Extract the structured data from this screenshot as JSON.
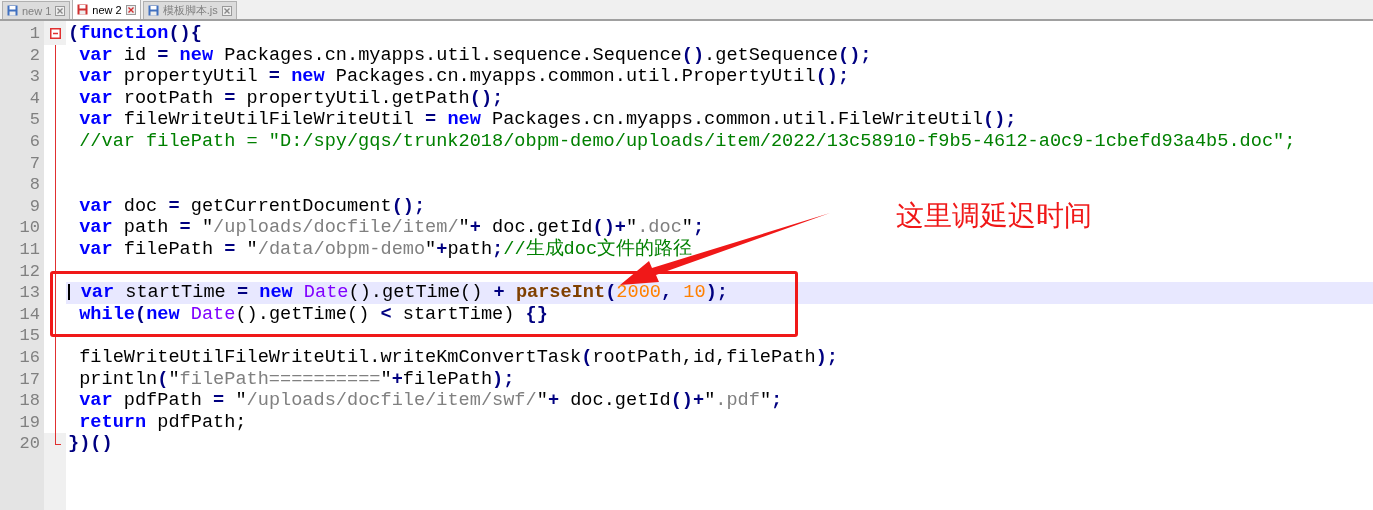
{
  "tabs": [
    {
      "label": "new 1",
      "selected": false
    },
    {
      "label": "new 2",
      "selected": true
    },
    {
      "label": "模板脚本.js",
      "selected": false
    }
  ],
  "lines": [
    {
      "number": "1",
      "kind": "fold_start",
      "current": false,
      "tokens": [
        {
          "kind": "operator",
          "t": "("
        },
        {
          "kind": "keyword",
          "t": "function"
        },
        {
          "kind": "operator",
          "t": "(){"
        }
      ]
    },
    {
      "number": "2",
      "kind": "folded",
      "current": false,
      "tokens": [
        {
          "kind": "keyword",
          "t": " var"
        },
        {
          "kind": "plain",
          "t": " id "
        },
        {
          "kind": "operator",
          "t": "="
        },
        {
          "kind": "keyword",
          "t": " new"
        },
        {
          "kind": "plain",
          "t": " Packages.cn.myapps.util.sequence.Sequence"
        },
        {
          "kind": "operator",
          "t": "()"
        },
        {
          "kind": "plain",
          "t": ".getSequence"
        },
        {
          "kind": "operator",
          "t": "();"
        }
      ]
    },
    {
      "number": "3",
      "kind": "folded",
      "current": false,
      "tokens": [
        {
          "kind": "keyword",
          "t": " var"
        },
        {
          "kind": "plain",
          "t": " propertyUtil "
        },
        {
          "kind": "operator",
          "t": "="
        },
        {
          "kind": "keyword",
          "t": " new"
        },
        {
          "kind": "plain",
          "t": " Packages.cn.myapps.common.util.PropertyUtil"
        },
        {
          "kind": "operator",
          "t": "();"
        }
      ]
    },
    {
      "number": "4",
      "kind": "folded",
      "current": false,
      "tokens": [
        {
          "kind": "keyword",
          "t": " var"
        },
        {
          "kind": "plain",
          "t": " rootPath "
        },
        {
          "kind": "operator",
          "t": "="
        },
        {
          "kind": "plain",
          "t": " propertyUtil.getPath"
        },
        {
          "kind": "operator",
          "t": "();"
        }
      ]
    },
    {
      "number": "5",
      "kind": "folded",
      "current": false,
      "tokens": [
        {
          "kind": "keyword",
          "t": " var"
        },
        {
          "kind": "plain",
          "t": " fileWriteUtilFileWriteUtil "
        },
        {
          "kind": "operator",
          "t": "="
        },
        {
          "kind": "keyword",
          "t": " new"
        },
        {
          "kind": "plain",
          "t": " Packages.cn.myapps.common.util.FileWriteUtil"
        },
        {
          "kind": "operator",
          "t": "();"
        }
      ]
    },
    {
      "number": "6",
      "kind": "folded",
      "current": false,
      "tokens": [
        {
          "kind": "comment",
          "t": " //var filePath = \"D:/spy/gqs/trunk2018/obpm-demo/uploads/item/2022/13c58910-f9b5-4612-a0c9-1cbefd93a4b5.doc\";"
        }
      ]
    },
    {
      "number": "7",
      "kind": "folded",
      "current": false
    },
    {
      "number": "8",
      "kind": "folded",
      "current": false
    },
    {
      "number": "9",
      "kind": "folded",
      "current": false,
      "tokens": [
        {
          "kind": "keyword",
          "t": " var"
        },
        {
          "kind": "plain",
          "t": " doc "
        },
        {
          "kind": "operator",
          "t": "="
        },
        {
          "kind": "plain",
          "t": " getCurrentDocument"
        },
        {
          "kind": "operator",
          "t": "();"
        }
      ]
    },
    {
      "number": "10",
      "kind": "folded",
      "current": false,
      "tokens": [
        {
          "kind": "keyword",
          "t": " var"
        },
        {
          "kind": "plain",
          "t": " path "
        },
        {
          "kind": "operator",
          "t": "="
        },
        {
          "kind": "quote",
          "t": " \""
        },
        {
          "kind": "string",
          "t": "/uploads/docfile/item/"
        },
        {
          "kind": "quote",
          "t": "\""
        },
        {
          "kind": "operator",
          "t": "+"
        },
        {
          "kind": "plain",
          "t": " doc.getId"
        },
        {
          "kind": "operator",
          "t": "()+"
        },
        {
          "kind": "quote",
          "t": "\""
        },
        {
          "kind": "string",
          "t": ".doc"
        },
        {
          "kind": "quote",
          "t": "\""
        },
        {
          "kind": "operator",
          "t": ";"
        }
      ]
    },
    {
      "number": "11",
      "kind": "folded",
      "current": false,
      "tokens": [
        {
          "kind": "keyword",
          "t": " var"
        },
        {
          "kind": "plain",
          "t": " filePath "
        },
        {
          "kind": "operator",
          "t": "="
        },
        {
          "kind": "quote",
          "t": " \""
        },
        {
          "kind": "string",
          "t": "/data/obpm-demo"
        },
        {
          "kind": "quote",
          "t": "\""
        },
        {
          "kind": "operator",
          "t": "+"
        },
        {
          "kind": "plain",
          "t": "path"
        },
        {
          "kind": "operator",
          "t": ";"
        },
        {
          "kind": "comment",
          "t": "//生成doc文件的路径"
        }
      ]
    },
    {
      "number": "12",
      "kind": "folded",
      "current": false
    },
    {
      "number": "13",
      "kind": "folded",
      "current": true,
      "tokens": [
        {
          "kind": "keyword",
          "t": " var"
        },
        {
          "kind": "plain",
          "t": " startTime "
        },
        {
          "kind": "operator",
          "t": "="
        },
        {
          "kind": "keyword",
          "t": " new"
        },
        {
          "kind": "type",
          "t": " Date"
        },
        {
          "kind": "plain",
          "t": "().getTime() "
        },
        {
          "kind": "operator",
          "t": "+"
        },
        {
          "kind": "function",
          "t": " parseInt"
        },
        {
          "kind": "operator",
          "t": "("
        },
        {
          "kind": "number",
          "t": "2000"
        },
        {
          "kind": "operator",
          "t": ","
        },
        {
          "kind": "number",
          "t": " 10"
        },
        {
          "kind": "operator",
          "t": ");"
        }
      ]
    },
    {
      "number": "14",
      "kind": "folded",
      "current": false,
      "tokens": [
        {
          "kind": "keyword",
          "t": " while"
        },
        {
          "kind": "operator",
          "t": "("
        },
        {
          "kind": "keyword",
          "t": "new"
        },
        {
          "kind": "type",
          "t": " Date"
        },
        {
          "kind": "plain",
          "t": "().getTime() "
        },
        {
          "kind": "operator",
          "t": "<"
        },
        {
          "kind": "plain",
          "t": " startTime) "
        },
        {
          "kind": "operator",
          "t": "{}"
        }
      ]
    },
    {
      "number": "15",
      "kind": "folded",
      "current": false
    },
    {
      "number": "16",
      "kind": "folded",
      "current": false,
      "tokens": [
        {
          "kind": "plain",
          "t": " fileWriteUtilFileWriteUtil.writeKmConvertTask"
        },
        {
          "kind": "operator",
          "t": "("
        },
        {
          "kind": "plain",
          "t": "rootPath,id,filePath"
        },
        {
          "kind": "operator",
          "t": ");"
        }
      ]
    },
    {
      "number": "17",
      "kind": "folded",
      "current": false,
      "tokens": [
        {
          "kind": "plain",
          "t": " println"
        },
        {
          "kind": "operator",
          "t": "("
        },
        {
          "kind": "quote",
          "t": "\""
        },
        {
          "kind": "string",
          "t": "filePath=========="
        },
        {
          "kind": "quote",
          "t": "\""
        },
        {
          "kind": "operator",
          "t": "+"
        },
        {
          "kind": "plain",
          "t": "filePath"
        },
        {
          "kind": "operator",
          "t": ");"
        }
      ]
    },
    {
      "number": "18",
      "kind": "folded",
      "current": false,
      "tokens": [
        {
          "kind": "keyword",
          "t": " var"
        },
        {
          "kind": "plain",
          "t": " pdfPath "
        },
        {
          "kind": "operator",
          "t": "="
        },
        {
          "kind": "quote",
          "t": " \""
        },
        {
          "kind": "string",
          "t": "/uploads/docfile/item/swf/"
        },
        {
          "kind": "quote",
          "t": "\""
        },
        {
          "kind": "operator",
          "t": "+"
        },
        {
          "kind": "plain",
          "t": " doc.getId"
        },
        {
          "kind": "operator",
          "t": "()+"
        },
        {
          "kind": "quote",
          "t": "\""
        },
        {
          "kind": "string",
          "t": ".pdf"
        },
        {
          "kind": "quote",
          "t": "\""
        },
        {
          "kind": "operator",
          "t": ";"
        }
      ]
    },
    {
      "number": "19",
      "kind": "folded",
      "current": false,
      "tokens": [
        {
          "kind": "keyword",
          "t": " return"
        },
        {
          "kind": "plain",
          "t": " pdfPath;"
        }
      ]
    },
    {
      "number": "20",
      "kind": "fold_end",
      "current": false,
      "tokens": [
        {
          "kind": "operator",
          "t": "})()"
        }
      ]
    }
  ],
  "annotation": {
    "text": "这里调延迟时间"
  }
}
